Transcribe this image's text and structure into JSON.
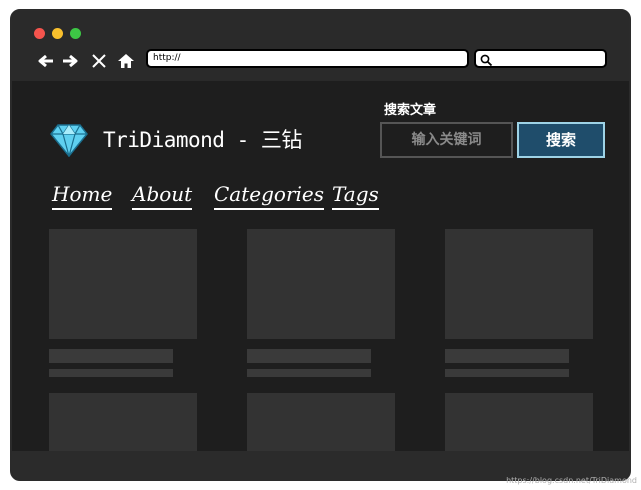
{
  "browser": {
    "url": "http://"
  },
  "site": {
    "title": "TriDiamond - 三钻",
    "search": {
      "label": "搜索文章",
      "placeholder": "输入关键词",
      "button": "搜索"
    },
    "menu": [
      {
        "label": "Home"
      },
      {
        "label": "About"
      },
      {
        "label": "Categories"
      },
      {
        "label": "Tags"
      }
    ]
  },
  "watermark": "https://blog.csdn.net/TriDiamond",
  "colors": {
    "background": "#1e1e1e",
    "card": "#333333",
    "search_button": "#1f4d6b",
    "search_button_border": "#9ed3e6",
    "diamond": "#5fd0f0"
  },
  "icons": [
    "back-arrow-icon",
    "forward-arrow-icon",
    "close-icon",
    "home-icon",
    "search-icon",
    "diamond-logo-icon"
  ]
}
